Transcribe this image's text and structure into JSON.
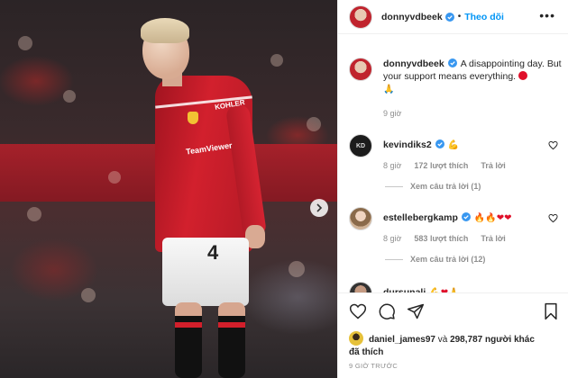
{
  "photo": {
    "shirt_sponsor": "TeamViewer",
    "shirt_badge": "KOHLER",
    "shorts_number": "4"
  },
  "header": {
    "username": "donnyvdbeek",
    "separator": "•",
    "follow_label": "Theo dõi",
    "more": "•••"
  },
  "caption": {
    "username": "donnyvdbeek",
    "text": "A disappointing day. But your support means everything.",
    "emoji": "🙏",
    "time": "9 giờ"
  },
  "comments": [
    {
      "username": "kevindiks2",
      "avatar_text": "KD",
      "text": "💪",
      "time": "8 giờ",
      "likes": "172 lượt thích",
      "reply_label": "Trả lời",
      "view_replies": "Xem câu trả lời (1)"
    },
    {
      "username": "estellebergkamp",
      "text": "🔥🔥❤❤",
      "time": "8 giờ",
      "likes": "583 lượt thích",
      "reply_label": "Trả lời",
      "view_replies": "Xem câu trả lời (12)"
    },
    {
      "username": "dursunali",
      "text": "💪❤🙏"
    }
  ],
  "actions": {
    "liked_by_user": "daniel_james97",
    "liked_joiner": "và",
    "liked_count": "298,787 người khác",
    "liked_suffix": "đã thích",
    "timestamp": "9 GIỜ TRƯỚC"
  },
  "colors": {
    "accent": "#0095f6",
    "verified": "#3897f0",
    "muted": "#8e8e8e",
    "heart": "#e0102a"
  }
}
